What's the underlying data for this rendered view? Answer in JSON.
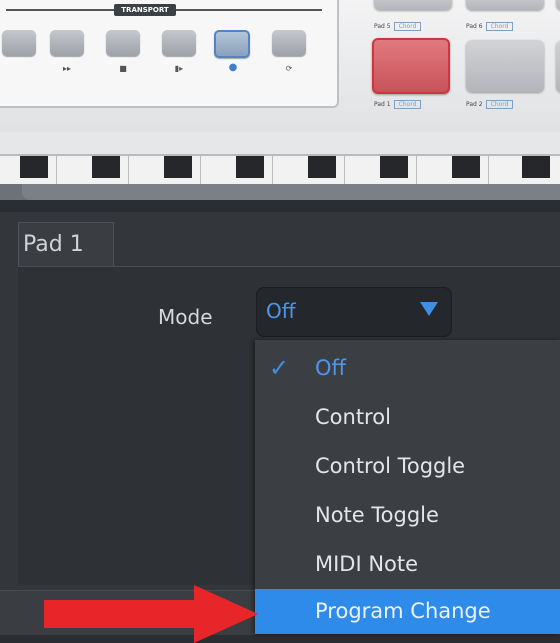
{
  "device": {
    "transport_label": "TRANSPORT",
    "transport_icons": [
      "▸▸",
      "■",
      "▮▸",
      "●",
      "⟳"
    ],
    "pads": [
      {
        "label": "Pad 5",
        "tag": "Chord"
      },
      {
        "label": "Pad 6",
        "tag": "Chord"
      },
      {
        "label": "Pad 1",
        "tag": "Chord"
      },
      {
        "label": "Pad 2",
        "tag": "Chord"
      }
    ]
  },
  "editor": {
    "tab_label": "Pad 1",
    "mode_label": "Mode",
    "mode_value": "Off",
    "dropdown": {
      "options": [
        "Off",
        "Control",
        "Control Toggle",
        "Note Toggle",
        "MIDI Note",
        "Program Change"
      ],
      "selected": "Off",
      "highlighted": "Program Change",
      "check_icon": "✓"
    }
  },
  "colors": {
    "accent": "#2f8bea",
    "arrow": "#e8262a",
    "panel": "#33363a"
  }
}
